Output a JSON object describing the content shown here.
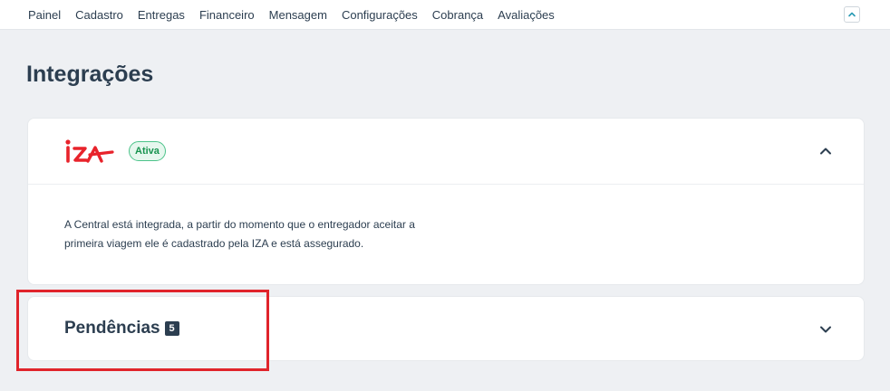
{
  "nav": {
    "items": [
      "Painel",
      "Cadastro",
      "Entregas",
      "Financeiro",
      "Mensagem",
      "Configurações",
      "Cobrança",
      "Avaliações"
    ]
  },
  "page": {
    "title": "Integrações"
  },
  "iza_card": {
    "logo_text": "IZA",
    "status_badge": "Ativa",
    "description": "A Central está integrada, a partir do momento que o entregador aceitar a primeira viagem ele é cadastrado pela IZA e está assegurado.",
    "expanded": true
  },
  "pendencias_card": {
    "title": "Pendências",
    "count": "5",
    "expanded": false
  },
  "colors": {
    "brand_red": "#e8232b",
    "badge_green": "#17934f",
    "highlight": "#e0242b",
    "text_dark": "#2c3e50"
  }
}
